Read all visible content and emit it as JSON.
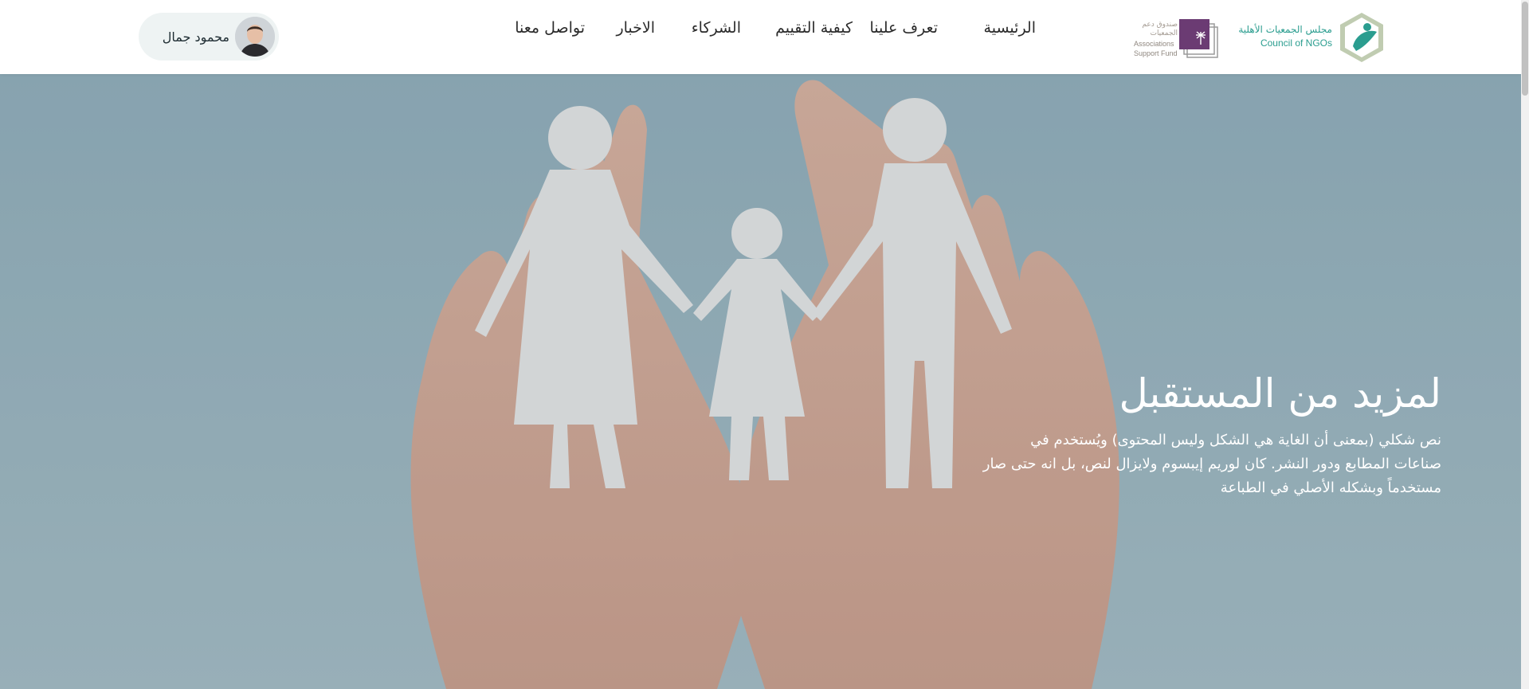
{
  "logos": {
    "ngo": {
      "ar": "مجلس الجمعيات الأهلية",
      "en": "Council of NGOs"
    },
    "fund": {
      "ar1": "صندوق دعم",
      "ar2": "الجمعيات",
      "en1": "Associations",
      "en2": "Support Fund"
    }
  },
  "nav": {
    "items": [
      {
        "label": "الرئيسية"
      },
      {
        "label": "تعرف علينا"
      },
      {
        "label": "كيفية التقييم"
      },
      {
        "label": "الشركاء"
      },
      {
        "label": "الاخبار"
      },
      {
        "label": "تواصل معنا"
      }
    ]
  },
  "user": {
    "name": "محمود جمال"
  },
  "hero": {
    "title": "لمزيد من المستقبل",
    "text": "نص شكلي (بمعنى أن الغاية هي الشكل وليس المحتوى) ويُستخدم في صناعات المطابع ودور النشر. كان لوريم إيبسوم ولايزال لنص، بل انه حتى صار مستخدماً وبشكله الأصلي في الطباعة"
  },
  "colors": {
    "brand_teal": "#2a9d8f",
    "fund_purple": "#6b3b73",
    "hero_bg": "#8ea9b3"
  }
}
